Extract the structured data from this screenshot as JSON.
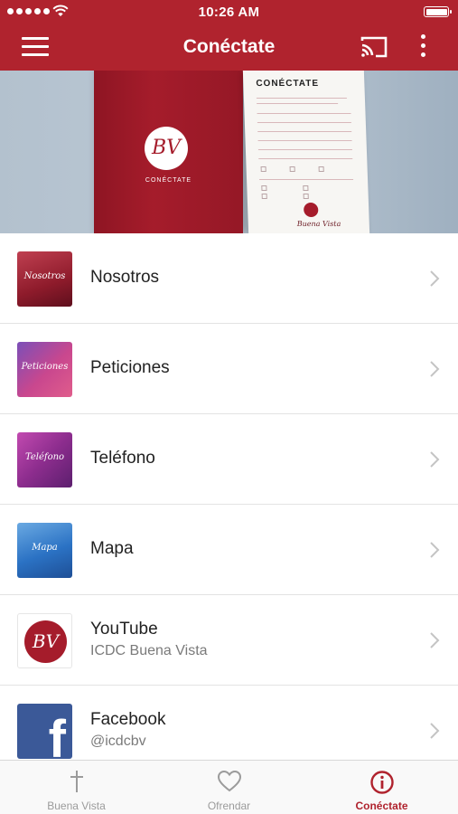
{
  "status_bar": {
    "time": "10:26 AM"
  },
  "nav": {
    "title": "Conéctate"
  },
  "hero": {
    "folder_logo": "BV",
    "folder_label": "CONÉCTATE",
    "form_title": "CONÉCTATE",
    "form_footer": "Buena Vista"
  },
  "items": [
    {
      "label": "Nosotros",
      "subtitle": "",
      "thumb_text": "Nosotros",
      "icon": "nosotros-thumbnail"
    },
    {
      "label": "Peticiones",
      "subtitle": "",
      "thumb_text": "Peticiones",
      "icon": "peticiones-thumbnail"
    },
    {
      "label": "Teléfono",
      "subtitle": "",
      "thumb_text": "Teléfono",
      "icon": "telefono-thumbnail"
    },
    {
      "label": "Mapa",
      "subtitle": "",
      "thumb_text": "Mapa",
      "icon": "mapa-thumbnail"
    },
    {
      "label": "YouTube",
      "subtitle": "ICDC Buena Vista",
      "thumb_text": "BV",
      "icon": "bv-logo-icon"
    },
    {
      "label": "Facebook",
      "subtitle": "@icdcbv",
      "thumb_text": "f",
      "icon": "facebook-icon"
    }
  ],
  "tabs": [
    {
      "label": "Buena Vista",
      "icon": "cross-icon",
      "active": false
    },
    {
      "label": "Ofrendar",
      "icon": "heart-icon",
      "active": false
    },
    {
      "label": "Conéctate",
      "icon": "info-icon",
      "active": true
    }
  ],
  "colors": {
    "brand": "#b0232e",
    "tab_inactive": "#9b9b9b",
    "facebook": "#3b5998"
  }
}
